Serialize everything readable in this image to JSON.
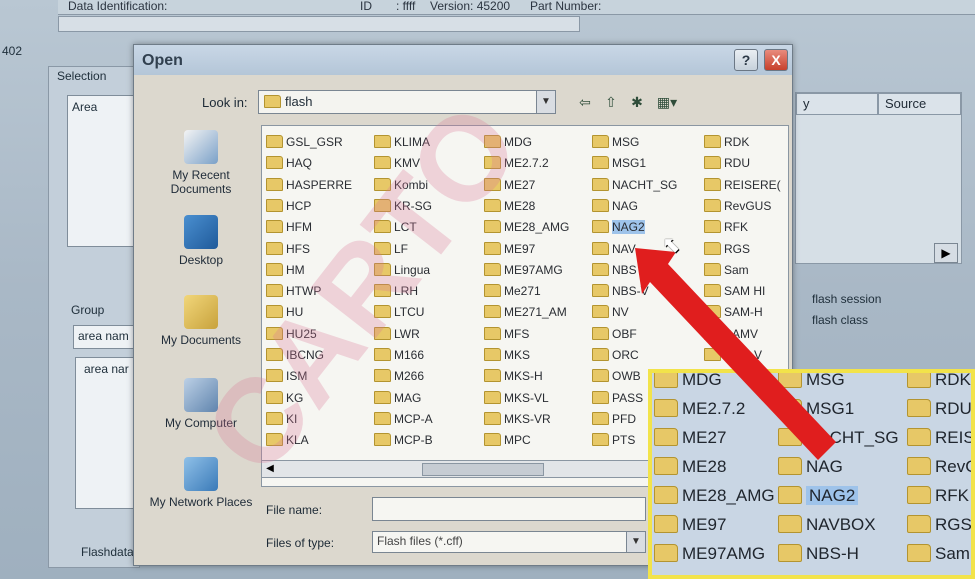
{
  "background": {
    "data_identification_label": "Data Identification:",
    "id_label": "ID",
    "id_value": ": ffff",
    "version_label": "Version: 45200",
    "part_number_label": "Part Number:",
    "left_code": "402",
    "selection_label": "Selection",
    "area_header": "Area",
    "source_header": "Source",
    "y_header": "y",
    "group_label": "Group",
    "area_name_1": "area nam",
    "area_name_2": "area nar",
    "flash_session": "flash session",
    "flash_class": "flash class",
    "flashdata_label": "Flashdata ad"
  },
  "dialog": {
    "title": "Open",
    "help_label": "?",
    "close_label": "X",
    "look_in_label": "Look in:",
    "look_in_value": "flash",
    "places": [
      {
        "label": "My Recent Documents",
        "icon": "recent-documents-icon"
      },
      {
        "label": "Desktop",
        "icon": "desktop-icon"
      },
      {
        "label": "My Documents",
        "icon": "my-documents-icon"
      },
      {
        "label": "My Computer",
        "icon": "my-computer-icon"
      },
      {
        "label": "My Network Places",
        "icon": "network-places-icon"
      }
    ],
    "file_name_label": "File name:",
    "file_name_value": "",
    "files_of_type_label": "Files of type:",
    "files_of_type_value": "Flash files (*.cff)",
    "columns": [
      [
        "GSL_GSR",
        "HAQ",
        "HASPERRE",
        "HCP",
        "HFM",
        "HFS",
        "HM",
        "HTWP",
        "HU",
        "HU25",
        "IBCNG",
        "ISM",
        "KG",
        "KI",
        "KLA"
      ],
      [
        "KLIMA",
        "KMV",
        "Kombi",
        "KR-SG",
        "LCT",
        "LF",
        "Lingua",
        "LRH",
        "LTCU",
        "LWR",
        "M166",
        "M266",
        "MAG",
        "MCP-A",
        "MCP-B"
      ],
      [
        "MDG",
        "ME2.7.2",
        "ME27",
        "ME28",
        "ME28_AMG",
        "ME97",
        "ME97AMG",
        "Me271",
        "ME271_AM",
        "MFS",
        "MKS",
        "MKS-H",
        "MKS-VL",
        "MKS-VR",
        "MPC"
      ],
      [
        "MSG",
        "MSG1",
        "NACHT_SG",
        "NAG",
        "NAG2",
        "NAV",
        "NBS",
        "NBS-V",
        "NV",
        "OBF",
        "ORC",
        "OWB",
        "PASS",
        "PFD",
        "PTS"
      ],
      [
        "RDK",
        "RDU",
        "REISERE(",
        "RevGUS",
        "RFK",
        "RGS",
        "Sam",
        "SAM HI",
        "SAM-H",
        "SAMV",
        "SAM-V",
        "",
        "",
        "",
        ""
      ]
    ],
    "selected_item": "NAG2"
  },
  "watermark": "CARTO",
  "zoom_inset": {
    "col1": [
      "MDG",
      "ME2.7.2",
      "ME27",
      "ME28",
      "ME28_AMG",
      "ME97",
      "ME97AMG"
    ],
    "col2": [
      "MSG",
      "MSG1",
      "NACHT_SG",
      "NAG",
      "NAG2",
      "NAVBOX",
      "NBS-H"
    ],
    "col3": [
      "RDK",
      "RDU",
      "REISER",
      "RevGU",
      "RFK",
      "RGS",
      "Sam"
    ],
    "selected_item": "NAG2",
    "border_color": "#f2e34a"
  },
  "annotation_arrow_color": "#e01e1e"
}
